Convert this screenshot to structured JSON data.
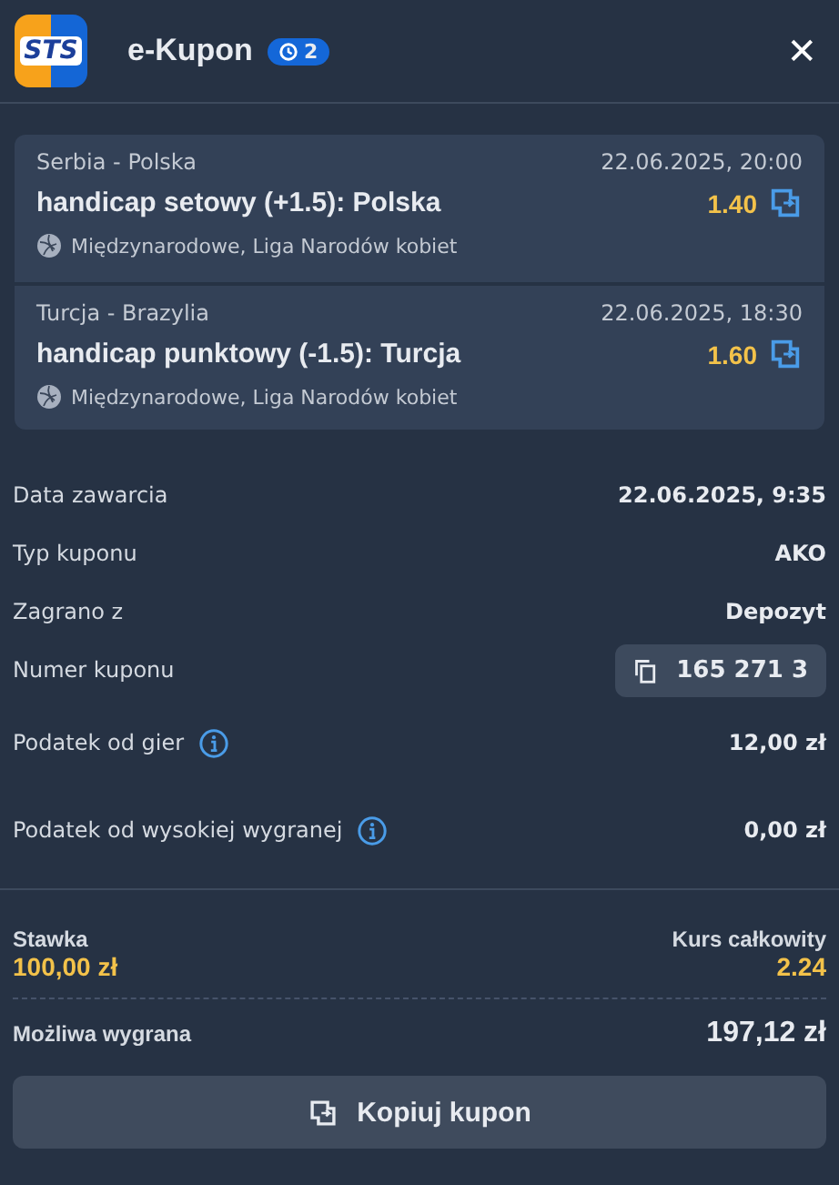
{
  "header": {
    "logo": "STS",
    "title": "e-Kupon",
    "badge": "2",
    "close": "✕"
  },
  "bets": [
    {
      "match": "Serbia - Polska",
      "datetime": "22.06.2025, 20:00",
      "selection": "handicap setowy (+1.5): Polska",
      "odds": "1.40",
      "league": "Międzynarodowe, Liga Narodów kobiet"
    },
    {
      "match": "Turcja - Brazylia",
      "datetime": "22.06.2025, 18:30",
      "selection": "handicap punktowy (-1.5): Turcja",
      "odds": "1.60",
      "league": "Międzynarodowe, Liga Narodów kobiet"
    }
  ],
  "details": [
    {
      "kind": "plain",
      "label": "Data zawarcia",
      "value": "22.06.2025, 9:35"
    },
    {
      "kind": "plain",
      "label": "Typ kuponu",
      "value": "AKO"
    },
    {
      "kind": "plain",
      "label": "Zagrano z",
      "value": "Depozyt"
    },
    {
      "kind": "copy",
      "label": "Numer kuponu",
      "value": "165 271 3"
    },
    {
      "kind": "info",
      "label": "Podatek od gier",
      "value": "12,00 zł"
    },
    {
      "kind": "info",
      "label": "Podatek od wysokiej wygranej",
      "value": "0,00 zł"
    }
  ],
  "summary": {
    "stake_label": "Stawka",
    "stake": "100,00 zł",
    "total_odds_label": "Kurs całkowity",
    "total_odds": "2.24",
    "win_label": "Możliwa wygrana",
    "win": "197,12 zł"
  },
  "copy_button": "Kopiuj kupon"
}
